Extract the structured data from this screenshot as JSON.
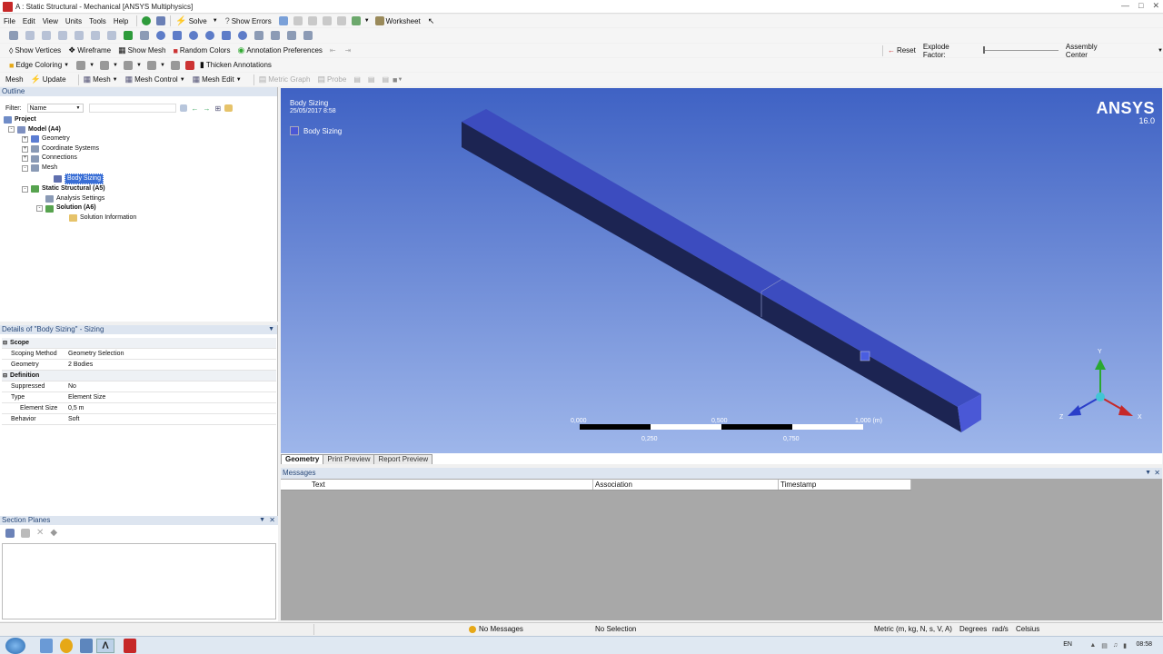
{
  "window": {
    "title": "A : Static Structural - Mechanical [ANSYS Multiphysics]"
  },
  "menu": [
    "File",
    "Edit",
    "View",
    "Units",
    "Tools",
    "Help"
  ],
  "toolbar1": {
    "solve": "Solve",
    "show_errors": "Show Errors",
    "worksheet": "Worksheet"
  },
  "toolbar3": {
    "show_vertices": "Show Vertices",
    "wireframe": "Wireframe",
    "show_mesh": "Show Mesh",
    "random_colors": "Random Colors",
    "annotation_prefs": "Annotation Preferences",
    "reset": "Reset",
    "explode_factor": "Explode Factor:",
    "assembly_center": "Assembly Center"
  },
  "toolbar4": {
    "edge_coloring": "Edge Coloring",
    "thicken": "Thicken Annotations"
  },
  "toolbar5": {
    "mesh": "Mesh",
    "update": "Update",
    "mesh_dd": "Mesh",
    "mesh_control": "Mesh Control",
    "mesh_edit": "Mesh Edit",
    "metric_graph": "Metric Graph",
    "probe": "Probe"
  },
  "outline": {
    "title": "Outline",
    "filter_label": "Filter:",
    "filter_value": "Name",
    "tree": [
      {
        "label": "Project",
        "level": 0,
        "bold": true
      },
      {
        "label": "Model (A4)",
        "level": 1,
        "bold": true
      },
      {
        "label": "Geometry",
        "level": 2
      },
      {
        "label": "Coordinate Systems",
        "level": 2
      },
      {
        "label": "Connections",
        "level": 2
      },
      {
        "label": "Mesh",
        "level": 2
      },
      {
        "label": "Body Sizing",
        "level": 3,
        "selected": true
      },
      {
        "label": "Static Structural (A5)",
        "level": 2,
        "bold": true
      },
      {
        "label": "Analysis Settings",
        "level": 3
      },
      {
        "label": "Solution (A6)",
        "level": 3,
        "bold": true
      },
      {
        "label": "Solution Information",
        "level": 4
      }
    ]
  },
  "details": {
    "title": "Details of \"Body Sizing\" - Sizing",
    "rows": [
      {
        "k": "Scope",
        "v": "",
        "section": true
      },
      {
        "k": "Scoping Method",
        "v": "Geometry Selection"
      },
      {
        "k": "Geometry",
        "v": "2 Bodies"
      },
      {
        "k": "Definition",
        "v": "",
        "section": true
      },
      {
        "k": "Suppressed",
        "v": "No"
      },
      {
        "k": "Type",
        "v": "Element Size"
      },
      {
        "k": "Element Size",
        "v": "0,5 m"
      },
      {
        "k": "Behavior",
        "v": "Soft"
      }
    ]
  },
  "section_planes": {
    "title": "Section Planes"
  },
  "viewport": {
    "label": "Body Sizing",
    "date": "25/05/2017 8:58",
    "legend": "Body Sizing",
    "brand": "ANSYS",
    "version": "16.0",
    "scale_top": [
      "0,000",
      "0,500",
      "1,000 (m)"
    ],
    "scale_bottom": [
      "0,250",
      "0,750"
    ],
    "axes": {
      "y": "Y",
      "z": "Z",
      "x": "X"
    },
    "colors": {
      "box_top": "#3c4cbf",
      "box_side": "#1c2452",
      "box_end": "#4a58d6"
    }
  },
  "tabs": [
    "Geometry",
    "Print Preview",
    "Report Preview"
  ],
  "messages": {
    "title": "Messages",
    "cols": [
      "Text",
      "Association",
      "Timestamp"
    ]
  },
  "status": {
    "messages": "No Messages",
    "selection": "No Selection",
    "units": "Metric (m, kg, N, s, V, A)",
    "deg": "Degrees",
    "rads": "rad/s",
    "temp": "Celsius"
  },
  "taskbar": {
    "lang": "EN",
    "time": "08:58"
  }
}
